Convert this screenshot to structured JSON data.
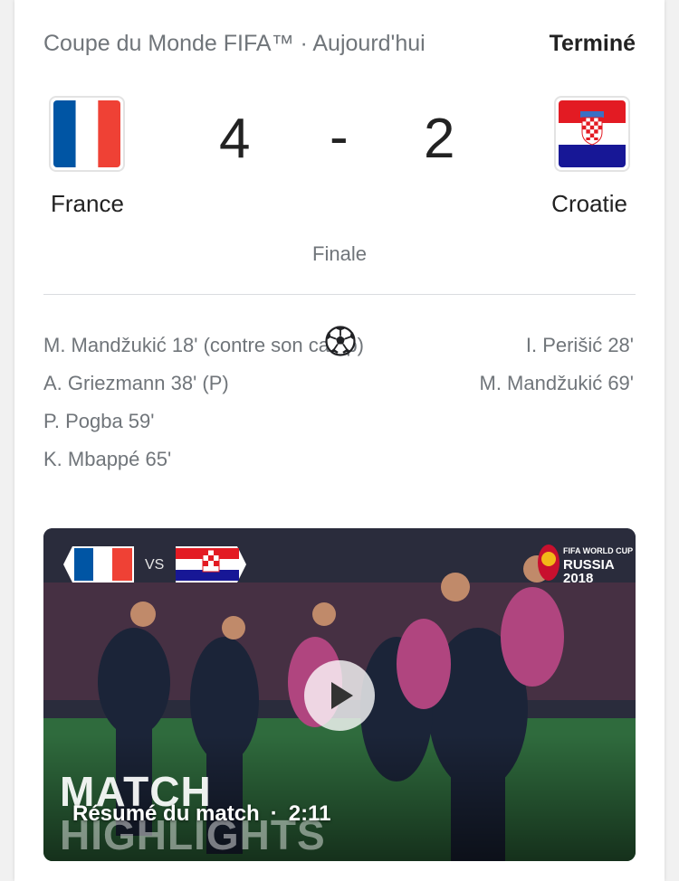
{
  "header": {
    "competition": "Coupe du Monde FIFA™ · Aujourd'hui",
    "status": "Terminé"
  },
  "match": {
    "home_team": "France",
    "away_team": "Croatie",
    "home_score": "4",
    "separator": "-",
    "away_score": "2",
    "round": "Finale"
  },
  "scorers": {
    "home": [
      "M. Mandžukić 18' (contre son camp)",
      "A. Griezmann 38' (P)",
      "P. Pogba 59'",
      "K. Mbappé 65'"
    ],
    "away": [
      "I. Perišić 28'",
      "M. Mandžukić 69'"
    ]
  },
  "video": {
    "vs_label": "VS",
    "logo_line1": "FIFA WORLD CUP",
    "logo_line2": "RUSSIA",
    "logo_line3": "2018",
    "overlay_word1": "MATCH",
    "overlay_word2": "HIGHLIGHTS",
    "title": "Résumé du match",
    "separator": "·",
    "duration": "2:11"
  },
  "colors": {
    "france_blue": "#0055a4",
    "france_red": "#ef4135",
    "croatia_red": "#e31b23",
    "croatia_blue": "#171796",
    "muted_text": "#70757a"
  }
}
